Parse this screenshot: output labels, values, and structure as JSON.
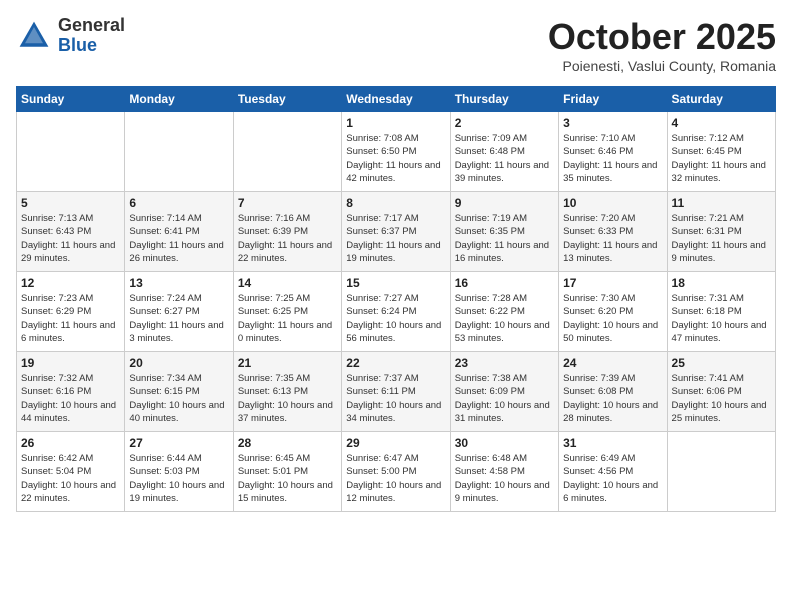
{
  "logo": {
    "general": "General",
    "blue": "Blue"
  },
  "title": "October 2025",
  "location": "Poienesti, Vaslui County, Romania",
  "days_of_week": [
    "Sunday",
    "Monday",
    "Tuesday",
    "Wednesday",
    "Thursday",
    "Friday",
    "Saturday"
  ],
  "weeks": [
    [
      {
        "day": "",
        "info": ""
      },
      {
        "day": "",
        "info": ""
      },
      {
        "day": "",
        "info": ""
      },
      {
        "day": "1",
        "info": "Sunrise: 7:08 AM\nSunset: 6:50 PM\nDaylight: 11 hours and 42 minutes."
      },
      {
        "day": "2",
        "info": "Sunrise: 7:09 AM\nSunset: 6:48 PM\nDaylight: 11 hours and 39 minutes."
      },
      {
        "day": "3",
        "info": "Sunrise: 7:10 AM\nSunset: 6:46 PM\nDaylight: 11 hours and 35 minutes."
      },
      {
        "day": "4",
        "info": "Sunrise: 7:12 AM\nSunset: 6:45 PM\nDaylight: 11 hours and 32 minutes."
      }
    ],
    [
      {
        "day": "5",
        "info": "Sunrise: 7:13 AM\nSunset: 6:43 PM\nDaylight: 11 hours and 29 minutes."
      },
      {
        "day": "6",
        "info": "Sunrise: 7:14 AM\nSunset: 6:41 PM\nDaylight: 11 hours and 26 minutes."
      },
      {
        "day": "7",
        "info": "Sunrise: 7:16 AM\nSunset: 6:39 PM\nDaylight: 11 hours and 22 minutes."
      },
      {
        "day": "8",
        "info": "Sunrise: 7:17 AM\nSunset: 6:37 PM\nDaylight: 11 hours and 19 minutes."
      },
      {
        "day": "9",
        "info": "Sunrise: 7:19 AM\nSunset: 6:35 PM\nDaylight: 11 hours and 16 minutes."
      },
      {
        "day": "10",
        "info": "Sunrise: 7:20 AM\nSunset: 6:33 PM\nDaylight: 11 hours and 13 minutes."
      },
      {
        "day": "11",
        "info": "Sunrise: 7:21 AM\nSunset: 6:31 PM\nDaylight: 11 hours and 9 minutes."
      }
    ],
    [
      {
        "day": "12",
        "info": "Sunrise: 7:23 AM\nSunset: 6:29 PM\nDaylight: 11 hours and 6 minutes."
      },
      {
        "day": "13",
        "info": "Sunrise: 7:24 AM\nSunset: 6:27 PM\nDaylight: 11 hours and 3 minutes."
      },
      {
        "day": "14",
        "info": "Sunrise: 7:25 AM\nSunset: 6:25 PM\nDaylight: 11 hours and 0 minutes."
      },
      {
        "day": "15",
        "info": "Sunrise: 7:27 AM\nSunset: 6:24 PM\nDaylight: 10 hours and 56 minutes."
      },
      {
        "day": "16",
        "info": "Sunrise: 7:28 AM\nSunset: 6:22 PM\nDaylight: 10 hours and 53 minutes."
      },
      {
        "day": "17",
        "info": "Sunrise: 7:30 AM\nSunset: 6:20 PM\nDaylight: 10 hours and 50 minutes."
      },
      {
        "day": "18",
        "info": "Sunrise: 7:31 AM\nSunset: 6:18 PM\nDaylight: 10 hours and 47 minutes."
      }
    ],
    [
      {
        "day": "19",
        "info": "Sunrise: 7:32 AM\nSunset: 6:16 PM\nDaylight: 10 hours and 44 minutes."
      },
      {
        "day": "20",
        "info": "Sunrise: 7:34 AM\nSunset: 6:15 PM\nDaylight: 10 hours and 40 minutes."
      },
      {
        "day": "21",
        "info": "Sunrise: 7:35 AM\nSunset: 6:13 PM\nDaylight: 10 hours and 37 minutes."
      },
      {
        "day": "22",
        "info": "Sunrise: 7:37 AM\nSunset: 6:11 PM\nDaylight: 10 hours and 34 minutes."
      },
      {
        "day": "23",
        "info": "Sunrise: 7:38 AM\nSunset: 6:09 PM\nDaylight: 10 hours and 31 minutes."
      },
      {
        "day": "24",
        "info": "Sunrise: 7:39 AM\nSunset: 6:08 PM\nDaylight: 10 hours and 28 minutes."
      },
      {
        "day": "25",
        "info": "Sunrise: 7:41 AM\nSunset: 6:06 PM\nDaylight: 10 hours and 25 minutes."
      }
    ],
    [
      {
        "day": "26",
        "info": "Sunrise: 6:42 AM\nSunset: 5:04 PM\nDaylight: 10 hours and 22 minutes."
      },
      {
        "day": "27",
        "info": "Sunrise: 6:44 AM\nSunset: 5:03 PM\nDaylight: 10 hours and 19 minutes."
      },
      {
        "day": "28",
        "info": "Sunrise: 6:45 AM\nSunset: 5:01 PM\nDaylight: 10 hours and 15 minutes."
      },
      {
        "day": "29",
        "info": "Sunrise: 6:47 AM\nSunset: 5:00 PM\nDaylight: 10 hours and 12 minutes."
      },
      {
        "day": "30",
        "info": "Sunrise: 6:48 AM\nSunset: 4:58 PM\nDaylight: 10 hours and 9 minutes."
      },
      {
        "day": "31",
        "info": "Sunrise: 6:49 AM\nSunset: 4:56 PM\nDaylight: 10 hours and 6 minutes."
      },
      {
        "day": "",
        "info": ""
      }
    ]
  ]
}
